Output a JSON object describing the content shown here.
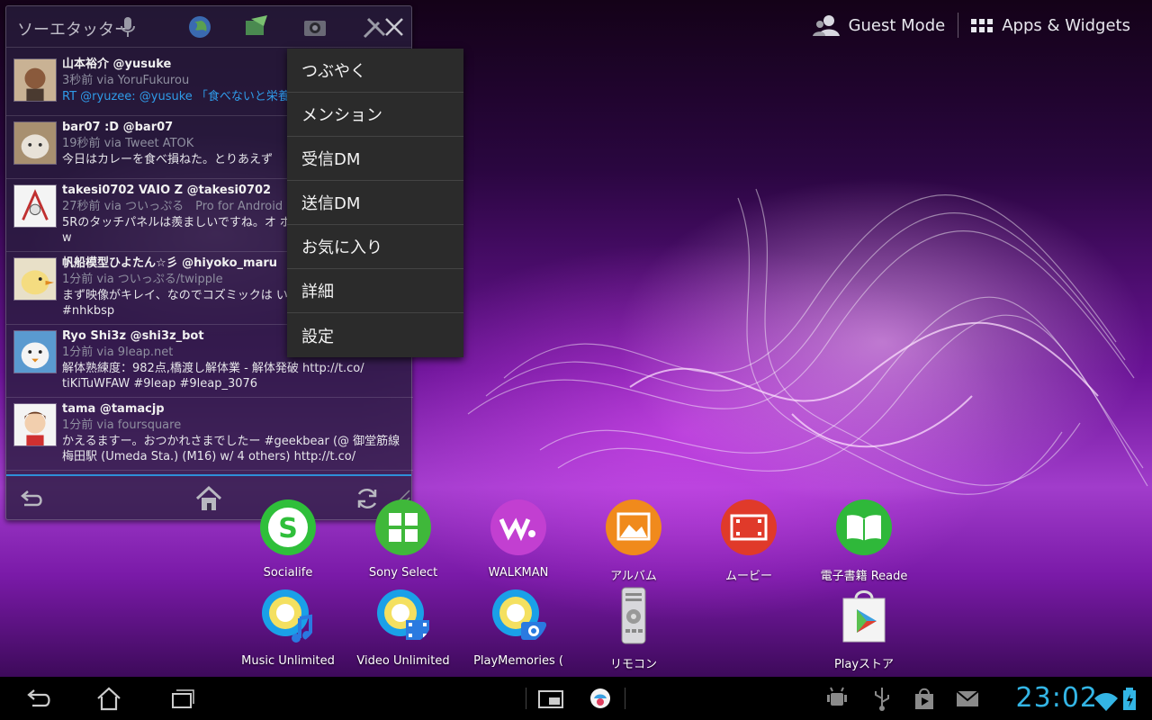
{
  "top_bar": {
    "guest_mode_label": "Guest Mode",
    "apps_widgets_label": "Apps & Widgets"
  },
  "widget": {
    "title": "ソーエタッター",
    "tweets": [
      {
        "name": "山本裕介 @yusuke",
        "meta": "3秒前 via YoruFukurou",
        "text": "RT @ryuzee: @yusuke 「食べないと栄養",
        "is_link": true
      },
      {
        "name": "bar07 :D @bar07",
        "meta": "19秒前 via Tweet ATOK",
        "text": "今日はカレーを食べ損ねた。とりあえず"
      },
      {
        "name": "takesi0702 VAIO Z @takesi0702",
        "meta": "27秒前 via ついっぷる　Pro for Android",
        "text": "5Rのタッチパネルは羨ましいですね。オ ボードの入力が楽チンw"
      },
      {
        "name": "帆船模型ひよたん☆彡 @hiyoko_maru",
        "meta": "1分前 via ついっぷる/twipple",
        "text": "まず映像がキレイ、なのでコズミックは い(*´∀`*)　(ぉ　#nhkbsp"
      },
      {
        "name": "Ryo Shi3z @shi3z_bot",
        "meta": "1分前 via 9leap.net",
        "text": "解体熟練度：982点,橋渡し解体業 - 解体発破 http://t.co/ tiKiTuWFAW #9leap #9leap_3076"
      },
      {
        "name": "tama @tamacjp",
        "meta": "1分前 via foursquare",
        "text": "かえるますー。おつかれさまでしたー #geekbear (@ 御堂筋線 梅田駅 (Umeda Sta.) (M16) w/ 4 others) http://t.co/"
      }
    ]
  },
  "popup_menu": {
    "items": [
      "つぶやく",
      "メンション",
      "受信DM",
      "送信DM",
      "お気に入り",
      "詳細",
      "設定"
    ]
  },
  "apps": [
    {
      "label": "Socialife",
      "icon": "socialife-icon",
      "color": "#2fbf3a"
    },
    {
      "label": "Sony Select",
      "icon": "sony-select-icon",
      "color": "#3fb83a"
    },
    {
      "label": "WALKMAN",
      "icon": "walkman-icon",
      "color": "#c23fd1"
    },
    {
      "label": "アルバム",
      "icon": "album-icon",
      "color": "#f08a1c"
    },
    {
      "label": "ムービー",
      "icon": "movie-icon",
      "color": "#e03a2a"
    },
    {
      "label": "電子書籍 Reade",
      "icon": "reader-icon",
      "color": "#2fb83a"
    },
    {
      "label": "Music Unlimited",
      "icon": "music-unlimited-icon",
      "color": "#1aa0e8"
    },
    {
      "label": "Video Unlimited",
      "icon": "video-unlimited-icon",
      "color": "#1aa0e8"
    },
    {
      "label": "PlayMemories (",
      "icon": "playmemories-icon",
      "color": "#1aa0e8"
    },
    {
      "label": "リモコン",
      "icon": "remote-icon",
      "color": "#bbbbbb"
    },
    {
      "label": "Playストア",
      "icon": "play-store-icon",
      "color": "#f4f4f4"
    }
  ],
  "system_bar": {
    "clock": "23:02"
  }
}
